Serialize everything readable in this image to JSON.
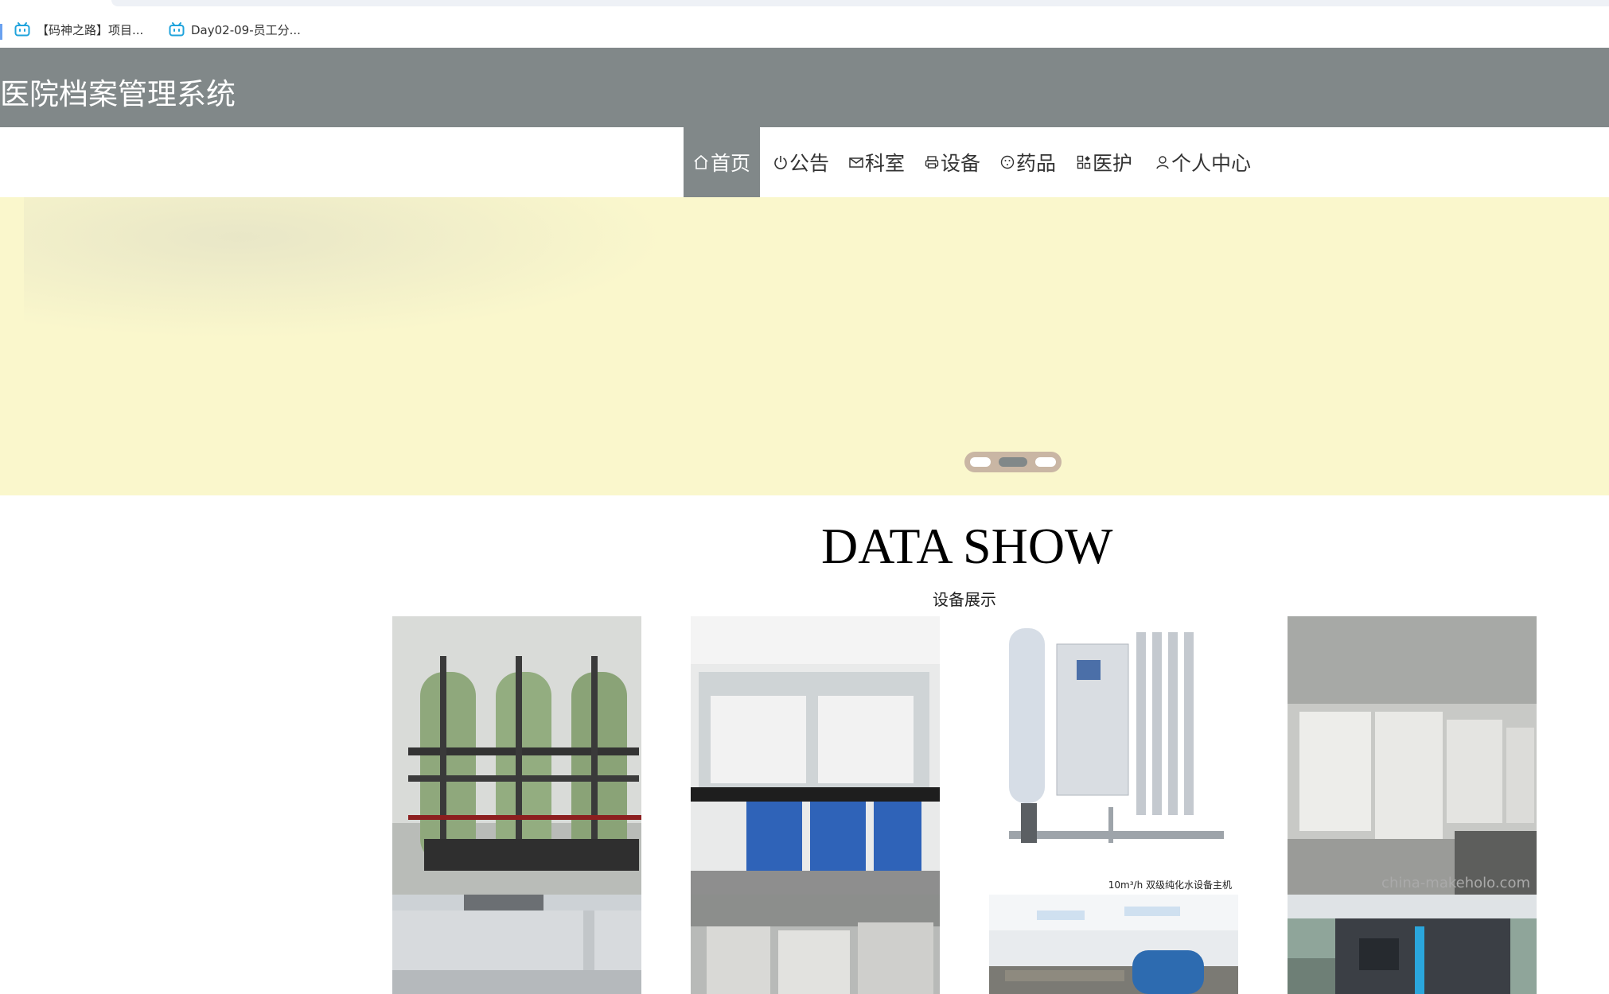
{
  "bookmarks": [
    {
      "label": "【码神之路】项目...",
      "icon": "bilibili-icon"
    },
    {
      "label": "Day02-09-员工分...",
      "icon": "bilibili-icon"
    }
  ],
  "header": {
    "title": "医院档案管理系统"
  },
  "nav": {
    "items": [
      {
        "label": "首页",
        "icon": "home-icon",
        "active": true
      },
      {
        "label": "公告",
        "icon": "power-icon",
        "active": false
      },
      {
        "label": "科室",
        "icon": "mail-icon",
        "active": false
      },
      {
        "label": "设备",
        "icon": "printer-icon",
        "active": false
      },
      {
        "label": "药品",
        "icon": "compass-icon",
        "active": false
      },
      {
        "label": "医护",
        "icon": "apps-icon",
        "active": false
      },
      {
        "label": "个人中心",
        "icon": "user-icon",
        "active": false
      }
    ]
  },
  "carousel": {
    "slide_count": 3,
    "active_index": 1,
    "background": "#faf7cc"
  },
  "section": {
    "title": "DATA SHOW",
    "subtitle": "设备展示"
  },
  "gallery": {
    "items": [
      {
        "kind": "water-softener-tanks-image"
      },
      {
        "kind": "lab-fume-hood-image"
      },
      {
        "kind": "ro-water-system-image",
        "caption": "10m³/h 双级纯化水设备主机"
      },
      {
        "kind": "factory-test-chambers-image",
        "caption": "china-makeholo.com"
      },
      {
        "kind": "factory-exterior-image"
      },
      {
        "kind": "production-line-image"
      },
      {
        "kind": "industrial-tanks-image"
      },
      {
        "kind": "industrial-machine-image"
      }
    ]
  },
  "colors": {
    "header_bg": "#818889",
    "hero_bg": "#faf7cc",
    "accent": "#818889"
  }
}
